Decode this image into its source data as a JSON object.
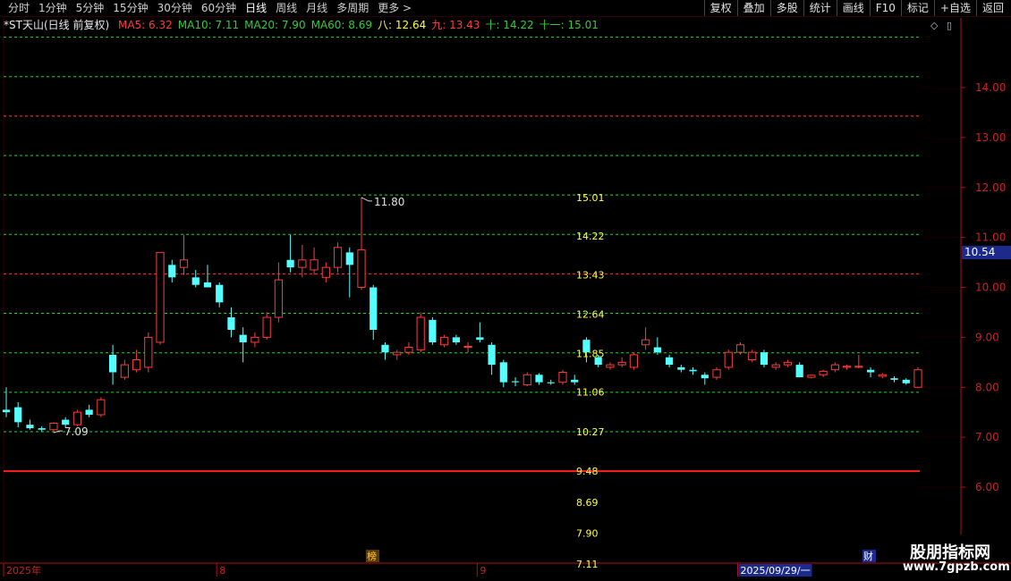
{
  "toolbar": {
    "periods": [
      "分时",
      "1分钟",
      "5分钟",
      "15分钟",
      "30分钟",
      "60分钟",
      "日线",
      "周线",
      "月线",
      "多周期",
      "更多 >"
    ],
    "actions": [
      "复权",
      "叠加",
      "多股",
      "统计",
      "画线",
      "F10",
      "标记",
      "+自选",
      "返回"
    ]
  },
  "legend": {
    "title": "*ST天山(日线 前复权)",
    "items": [
      {
        "label": "MA5: 6.32",
        "color": "#ff3b3b"
      },
      {
        "label": "MA10: 7.11",
        "color": "#33cc33"
      },
      {
        "label": "MA20: 7.90",
        "color": "#33cc33"
      },
      {
        "label": "MA60: 8.69",
        "color": "#33cc33"
      },
      {
        "label": "八: 12.64",
        "color": "#ffff33"
      },
      {
        "label": "九: 13.43",
        "color": "#ff3b3b"
      },
      {
        "label": "十: 14.22",
        "color": "#33cc33"
      },
      {
        "label": "十一: 15.01",
        "color": "#33cc33"
      }
    ]
  },
  "current_price": "10.54",
  "badges": {
    "bang": "榜",
    "cai": "财"
  },
  "watermark": {
    "line1": "股朋指标网",
    "line2": "www.7gpzb.com"
  },
  "chart_data": {
    "type": "candlestick",
    "title": "*ST天山(日线 前复权)",
    "ylim": [
      5.4,
      15.0
    ],
    "yticks": [
      6.0,
      7.0,
      8.0,
      9.0,
      10.0,
      11.0,
      12.0,
      13.0,
      14.0
    ],
    "grid": false,
    "x_labels": [
      {
        "index": 0,
        "label": "2025年"
      },
      {
        "index": 18,
        "label": "8"
      },
      {
        "index": 40,
        "label": "9"
      },
      {
        "index": 62,
        "label": "2025/09/29/一"
      }
    ],
    "annotations": [
      {
        "text": "11.80",
        "index": 30,
        "value": 11.8,
        "kind": "high"
      },
      {
        "text": "7.09",
        "index": 4,
        "value": 7.09,
        "kind": "low"
      }
    ],
    "level_lines": [
      {
        "value": 15.01,
        "color": "#33cc33",
        "style": "dashed"
      },
      {
        "value": 14.22,
        "color": "#33cc33",
        "style": "dashed"
      },
      {
        "value": 13.43,
        "color": "#ff3b3b",
        "style": "dashed"
      },
      {
        "value": 12.64,
        "color": "#33cc33",
        "style": "dashed"
      },
      {
        "value": 11.85,
        "color": "#33cc33",
        "style": "dashed"
      },
      {
        "value": 11.06,
        "color": "#33cc33",
        "style": "dashed"
      },
      {
        "value": 10.27,
        "color": "#ff3b3b",
        "style": "dashed"
      },
      {
        "value": 9.48,
        "color": "#33cc33",
        "style": "dashed"
      },
      {
        "value": 8.69,
        "color": "#33cc33",
        "style": "dashed"
      },
      {
        "value": 7.9,
        "color": "#33cc33",
        "style": "dashed"
      },
      {
        "value": 7.11,
        "color": "#33cc33",
        "style": "dashed"
      },
      {
        "value": 6.32,
        "color": "#ff2020",
        "style": "solid"
      }
    ],
    "level_labels": [
      {
        "text": "15.01",
        "value": 11.8
      },
      {
        "text": "14.22",
        "value": 11.03
      },
      {
        "text": "13.43",
        "value": 10.25
      },
      {
        "text": "12.64",
        "value": 9.46
      },
      {
        "text": "11.85",
        "value": 8.68
      },
      {
        "text": "11.06",
        "value": 7.91
      },
      {
        "text": "10.27",
        "value": 7.11
      },
      {
        "text": "9.48",
        "value": 6.32
      },
      {
        "text": "8.69",
        "value": 5.7
      },
      {
        "text": "7.90",
        "value": 5.08
      },
      {
        "text": "7.11",
        "value": 4.46
      }
    ],
    "candles": [
      {
        "o": 7.55,
        "h": 8.0,
        "l": 7.4,
        "c": 7.5
      },
      {
        "o": 7.6,
        "h": 7.7,
        "l": 7.2,
        "c": 7.3
      },
      {
        "o": 7.25,
        "h": 7.35,
        "l": 7.15,
        "c": 7.18
      },
      {
        "o": 7.18,
        "h": 7.22,
        "l": 7.12,
        "c": 7.15
      },
      {
        "o": 7.15,
        "h": 7.3,
        "l": 7.09,
        "c": 7.28
      },
      {
        "o": 7.35,
        "h": 7.4,
        "l": 7.2,
        "c": 7.25
      },
      {
        "o": 7.25,
        "h": 7.55,
        "l": 7.22,
        "c": 7.5
      },
      {
        "o": 7.55,
        "h": 7.65,
        "l": 7.4,
        "c": 7.45
      },
      {
        "o": 7.45,
        "h": 7.8,
        "l": 7.4,
        "c": 7.75
      },
      {
        "o": 8.65,
        "h": 8.85,
        "l": 8.05,
        "c": 8.3
      },
      {
        "o": 8.2,
        "h": 8.55,
        "l": 8.15,
        "c": 8.45
      },
      {
        "o": 8.35,
        "h": 8.75,
        "l": 8.3,
        "c": 8.55
      },
      {
        "o": 8.4,
        "h": 9.1,
        "l": 8.3,
        "c": 9.0
      },
      {
        "o": 8.9,
        "h": 10.7,
        "l": 8.85,
        "c": 10.7
      },
      {
        "o": 10.45,
        "h": 10.55,
        "l": 10.1,
        "c": 10.2
      },
      {
        "o": 10.4,
        "h": 11.05,
        "l": 10.25,
        "c": 10.55
      },
      {
        "o": 10.2,
        "h": 10.35,
        "l": 10.0,
        "c": 10.05
      },
      {
        "o": 10.1,
        "h": 10.45,
        "l": 10.0,
        "c": 10.0
      },
      {
        "o": 10.05,
        "h": 10.1,
        "l": 9.6,
        "c": 9.7
      },
      {
        "o": 9.4,
        "h": 9.6,
        "l": 9.0,
        "c": 9.15
      },
      {
        "o": 9.05,
        "h": 9.2,
        "l": 8.5,
        "c": 8.9
      },
      {
        "o": 8.9,
        "h": 9.1,
        "l": 8.8,
        "c": 9.0
      },
      {
        "o": 9.0,
        "h": 9.5,
        "l": 8.95,
        "c": 9.4
      },
      {
        "o": 9.4,
        "h": 10.5,
        "l": 9.3,
        "c": 10.15
      },
      {
        "o": 10.55,
        "h": 11.05,
        "l": 10.3,
        "c": 10.4
      },
      {
        "o": 10.4,
        "h": 10.85,
        "l": 10.2,
        "c": 10.55
      },
      {
        "o": 10.35,
        "h": 10.8,
        "l": 10.25,
        "c": 10.55
      },
      {
        "o": 10.2,
        "h": 10.5,
        "l": 10.1,
        "c": 10.4
      },
      {
        "o": 10.4,
        "h": 10.9,
        "l": 10.3,
        "c": 10.8
      },
      {
        "o": 10.7,
        "h": 10.8,
        "l": 9.8,
        "c": 10.45
      },
      {
        "o": 10.0,
        "h": 11.8,
        "l": 9.95,
        "c": 10.75
      },
      {
        "o": 10.0,
        "h": 10.05,
        "l": 8.95,
        "c": 9.15
      },
      {
        "o": 8.85,
        "h": 8.9,
        "l": 8.55,
        "c": 8.7
      },
      {
        "o": 8.65,
        "h": 8.75,
        "l": 8.55,
        "c": 8.7
      },
      {
        "o": 8.7,
        "h": 8.9,
        "l": 8.65,
        "c": 8.8
      },
      {
        "o": 8.75,
        "h": 9.5,
        "l": 8.7,
        "c": 9.4
      },
      {
        "o": 9.35,
        "h": 9.4,
        "l": 8.85,
        "c": 8.9
      },
      {
        "o": 8.85,
        "h": 9.05,
        "l": 8.8,
        "c": 9.0
      },
      {
        "o": 9.0,
        "h": 9.05,
        "l": 8.85,
        "c": 8.9
      },
      {
        "o": 8.8,
        "h": 8.9,
        "l": 8.7,
        "c": 8.82
      },
      {
        "o": 9.0,
        "h": 9.3,
        "l": 8.9,
        "c": 8.95
      },
      {
        "o": 8.85,
        "h": 8.9,
        "l": 8.25,
        "c": 8.45
      },
      {
        "o": 8.5,
        "h": 8.55,
        "l": 8.0,
        "c": 8.1
      },
      {
        "o": 8.12,
        "h": 8.2,
        "l": 8.02,
        "c": 8.1
      },
      {
        "o": 8.05,
        "h": 8.3,
        "l": 8.02,
        "c": 8.25
      },
      {
        "o": 8.25,
        "h": 8.28,
        "l": 8.05,
        "c": 8.1
      },
      {
        "o": 8.1,
        "h": 8.15,
        "l": 8.05,
        "c": 8.08
      },
      {
        "o": 8.1,
        "h": 8.35,
        "l": 8.05,
        "c": 8.3
      },
      {
        "o": 8.15,
        "h": 8.25,
        "l": 8.05,
        "c": 8.1
      },
      {
        "o": 8.95,
        "h": 9.0,
        "l": 8.5,
        "c": 8.7
      },
      {
        "o": 8.6,
        "h": 8.65,
        "l": 8.4,
        "c": 8.45
      },
      {
        "o": 8.4,
        "h": 8.5,
        "l": 8.35,
        "c": 8.45
      },
      {
        "o": 8.45,
        "h": 8.6,
        "l": 8.4,
        "c": 8.5
      },
      {
        "o": 8.4,
        "h": 8.7,
        "l": 8.35,
        "c": 8.65
      },
      {
        "o": 8.85,
        "h": 9.2,
        "l": 8.75,
        "c": 8.95
      },
      {
        "o": 8.8,
        "h": 9.0,
        "l": 8.65,
        "c": 8.7
      },
      {
        "o": 8.6,
        "h": 8.65,
        "l": 8.4,
        "c": 8.45
      },
      {
        "o": 8.4,
        "h": 8.45,
        "l": 8.3,
        "c": 8.35
      },
      {
        "o": 8.35,
        "h": 8.4,
        "l": 8.25,
        "c": 8.32
      },
      {
        "o": 8.25,
        "h": 8.3,
        "l": 8.05,
        "c": 8.18
      },
      {
        "o": 8.2,
        "h": 8.4,
        "l": 8.15,
        "c": 8.35
      },
      {
        "o": 8.4,
        "h": 8.75,
        "l": 8.35,
        "c": 8.7
      },
      {
        "o": 8.7,
        "h": 8.9,
        "l": 8.65,
        "c": 8.85
      },
      {
        "o": 8.55,
        "h": 8.75,
        "l": 8.5,
        "c": 8.7
      },
      {
        "o": 8.7,
        "h": 8.75,
        "l": 8.4,
        "c": 8.45
      },
      {
        "o": 8.4,
        "h": 8.5,
        "l": 8.35,
        "c": 8.45
      },
      {
        "o": 8.45,
        "h": 8.55,
        "l": 8.4,
        "c": 8.5
      },
      {
        "o": 8.45,
        "h": 8.5,
        "l": 8.2,
        "c": 8.2
      },
      {
        "o": 8.2,
        "h": 8.25,
        "l": 8.18,
        "c": 8.24
      },
      {
        "o": 8.25,
        "h": 8.35,
        "l": 8.2,
        "c": 8.32
      },
      {
        "o": 8.35,
        "h": 8.5,
        "l": 8.3,
        "c": 8.45
      },
      {
        "o": 8.4,
        "h": 8.45,
        "l": 8.35,
        "c": 8.42
      },
      {
        "o": 8.4,
        "h": 8.65,
        "l": 8.38,
        "c": 8.42
      },
      {
        "o": 8.35,
        "h": 8.4,
        "l": 8.2,
        "c": 8.3
      },
      {
        "o": 8.22,
        "h": 8.28,
        "l": 8.18,
        "c": 8.25
      },
      {
        "o": 8.18,
        "h": 8.22,
        "l": 8.1,
        "c": 8.15
      },
      {
        "o": 8.15,
        "h": 8.18,
        "l": 8.05,
        "c": 8.08
      },
      {
        "o": 8.0,
        "h": 8.4,
        "l": 7.98,
        "c": 8.35
      }
    ]
  }
}
